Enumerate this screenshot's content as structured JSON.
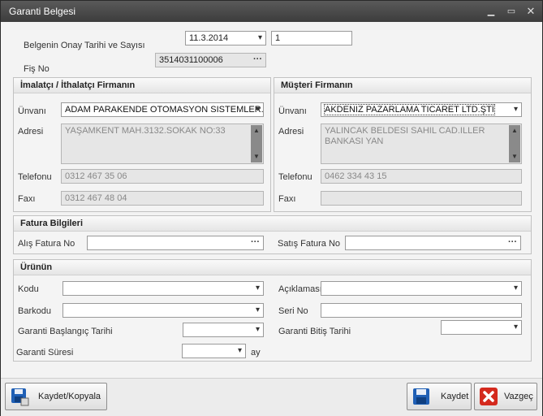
{
  "window": {
    "title": "Garanti Belgesi"
  },
  "header": {
    "onay_label": "Belgenin Onay Tarihi ve Sayısı",
    "onay_date": "11.3.2014",
    "onay_number": "1",
    "fis_label": "Fiş No",
    "fis_value": "3514031100006"
  },
  "imalatci": {
    "title": "İmalatçı / İthalatçı Firmanın",
    "unvan_label": "Ünvanı",
    "unvan_value": "ADAM PARAKENDE OTOMASYON SISTEMLER...",
    "adres_label": "Adresi",
    "adres_value": "YAŞAMKENT MAH.3132.SOKAK NO:33",
    "telefon_label": "Telefonu",
    "telefon_value": "0312 467 35 06",
    "faks_label": "Faxı",
    "faks_value": "0312 467 48 04"
  },
  "musteri": {
    "title": "Müşteri Firmanın",
    "unvan_label": "Ünvanı",
    "unvan_value": "AKDENIZ PAZARLAMA TICARET LTD.ŞTİ",
    "adres_label": "Adresi",
    "adres_value": "YALINCAK BELDESI SAHIL CAD.ILLER BANKASI YAN",
    "telefon_label": "Telefonu",
    "telefon_value": "0462 334 43 15",
    "faks_label": "Faxı",
    "faks_value": ""
  },
  "fatura": {
    "title": "Fatura Bilgileri",
    "alis_label": "Alış Fatura No",
    "alis_value": "",
    "satis_label": "Satış Fatura No",
    "satis_value": ""
  },
  "urun": {
    "title": "Ürünün",
    "kodu_label": "Kodu",
    "aciklama_label": "Açıklaması",
    "barkodu_label": "Barkodu",
    "seri_label": "Seri No",
    "baslangic_label": "Garanti Başlangıç Tarihi",
    "bitis_label": "Garanti Bitiş Tarihi",
    "sure_label": "Garanti Süresi",
    "sure_unit": "ay"
  },
  "footer": {
    "kaydet_kopyala": "Kaydet/Kopyala",
    "kaydet": "Kaydet",
    "vazgec": "Vazgeç"
  },
  "colors": {
    "accent": "#1f5fb5",
    "cancel": "#d42a1e"
  }
}
